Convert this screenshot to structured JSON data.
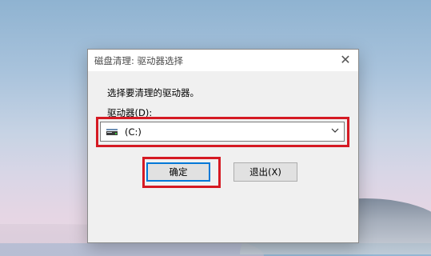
{
  "dialog": {
    "title": "磁盘清理: 驱动器选择",
    "close_glyph": "✕",
    "prompt": "选择要清理的驱动器。",
    "drive_label": "驱动器(D):",
    "drive_select": {
      "selected": "(C:)",
      "icon": "hard-drive-icon"
    },
    "ok_button": "确定",
    "exit_button": "退出(X)"
  },
  "colors": {
    "highlight_box": "#d51a23",
    "focus_border": "#0078d7",
    "dialog_bg": "#f0f0f0"
  }
}
